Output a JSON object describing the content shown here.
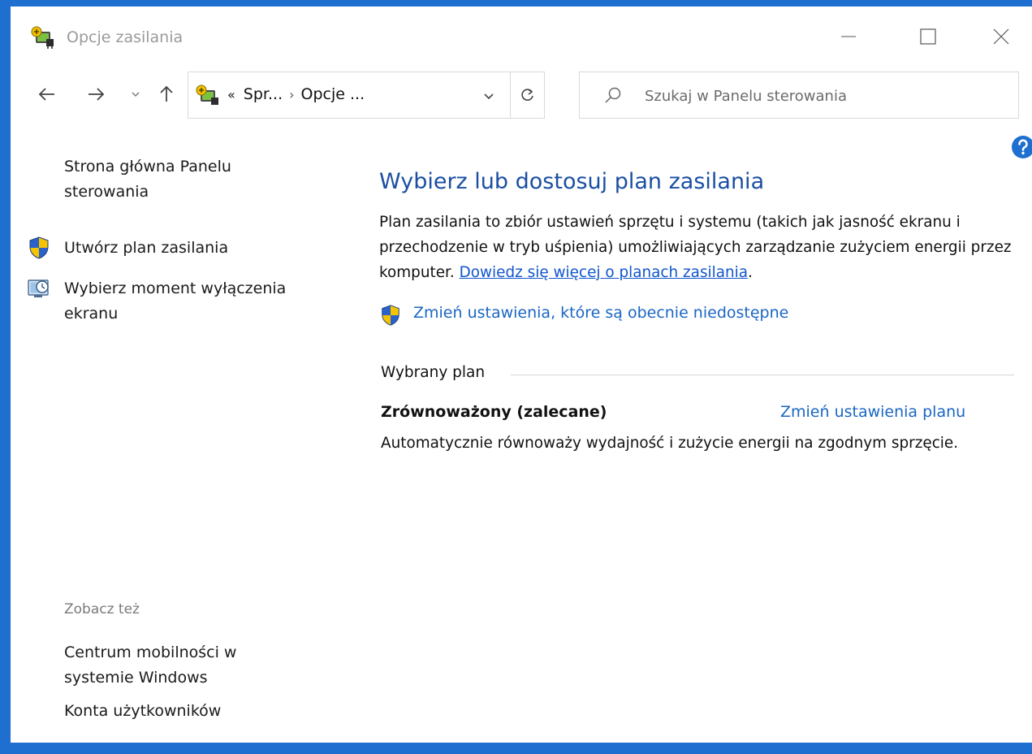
{
  "window": {
    "title": "Opcje zasilania"
  },
  "navigation": {
    "address": {
      "prefix": "«",
      "crumbs": [
        "Spr...",
        "Opcje ..."
      ],
      "separator": "›"
    },
    "search": {
      "placeholder": "Szukaj w Panelu sterowania",
      "value": ""
    }
  },
  "sidebar": {
    "home_link": "Strona główna Panelu sterowania",
    "tasks": [
      {
        "label": "Utwórz plan zasilania",
        "icon": "uac-shield-icon"
      },
      {
        "label": "Wybierz moment wyłączenia ekranu",
        "icon": "display-timer-icon"
      }
    ],
    "see_also_title": "Zobacz też",
    "see_also_links": [
      "Centrum mobilności w systemie Windows",
      "Konta użytkowników"
    ]
  },
  "main": {
    "heading": "Wybierz lub dostosuj plan zasilania",
    "description_text": "Plan zasilania to zbiór ustawień sprzętu i systemu (takich jak jasność ekranu i przechodzenie w tryb uśpienia) umożliwiających zarządzanie zużyciem energii przez komputer.",
    "description_link": "Dowiedz się więcej o planach zasilania",
    "description_end": ".",
    "uac_link": "Zmień ustawienia, które są obecnie niedostępne",
    "selected_plan_group": "Wybrany plan",
    "plan": {
      "name": "Zrównoważony (zalecane)",
      "change_link": "Zmień ustawienia planu",
      "description": "Automatycznie równoważy wydajność i zużycie energii na zgodnym sprzęcie."
    }
  },
  "colors": {
    "frame": "#1e6fd0",
    "heading": "#1a4fa3",
    "link": "#1a66c4",
    "inline_link": "#1155cc"
  }
}
